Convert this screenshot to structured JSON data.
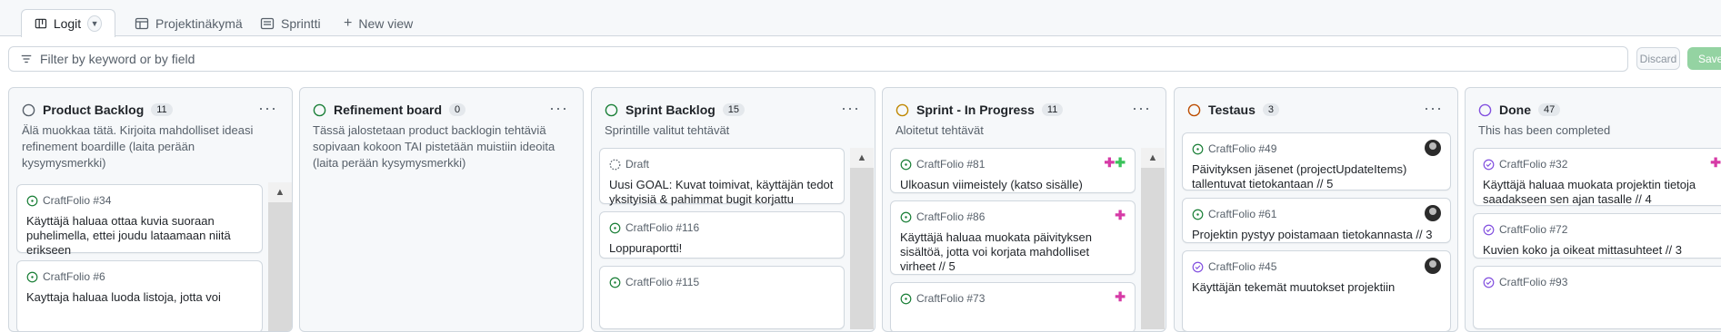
{
  "tabs": [
    {
      "label": "Logit",
      "icon": "table-icon"
    },
    {
      "label": "Projektinäkymä",
      "icon": "table-icon"
    },
    {
      "label": "Sprintti",
      "icon": "board-icon"
    },
    {
      "label": "New view",
      "icon": "plus-icon"
    }
  ],
  "filter": {
    "placeholder": "Filter by keyword or by field"
  },
  "actions": {
    "discard": "Discard",
    "save": "Save"
  },
  "colors": {
    "open": "#1a7f37",
    "todo": "#57606a",
    "progress": "#bf8700",
    "testing": "#bc4c00",
    "done": "#8250df",
    "label": "#d63aa6"
  },
  "columns": [
    {
      "title": "Product Backlog",
      "count": "11",
      "description": "Älä muokkaa tätä. Kirjoita mahdolliset ideasi refinement boardille (laita perään kysymysmerkki)",
      "cards": [
        {
          "meta": "CraftFolio #34",
          "title": "Käyttäjä haluaa ottaa kuvia suoraan puhelimella, ettei joudu lataamaan niitä erikseen"
        },
        {
          "meta": "CraftFolio #6",
          "title": "Kayttaja haluaa luoda listoja, jotta voi"
        }
      ]
    },
    {
      "title": "Refinement board",
      "count": "0",
      "description": "Tässä jalostetaan product backlogin tehtäviä sopivaan kokoon TAI pistetään muistiin ideoita (laita perään kysymysmerkki)",
      "cards": []
    },
    {
      "title": "Sprint Backlog",
      "count": "15",
      "description": "Sprintille valitut tehtävät",
      "cards": [
        {
          "meta": "Draft",
          "title": "Uusi GOAL: Kuvat toimivat, käyttäjän tedot yksityisiä & pahimmat bugit korjattu"
        },
        {
          "meta": "CraftFolio #116",
          "title": "Loppuraportti!"
        },
        {
          "meta": "CraftFolio #115",
          "title": ""
        }
      ]
    },
    {
      "title": "Sprint - In Progress",
      "count": "11",
      "description": "Aloitetut tehtävät",
      "cards": [
        {
          "meta": "CraftFolio #81",
          "title": "Ulkoasun viimeistely (katso sisälle)"
        },
        {
          "meta": "CraftFolio #86",
          "title": "Käyttäjä haluaa muokata päivityksen sisältöä, jotta voi korjata mahdolliset virheet // 5"
        },
        {
          "meta": "CraftFolio #73",
          "title": ""
        }
      ]
    },
    {
      "title": "Testaus",
      "count": "3",
      "description": "",
      "cards": [
        {
          "meta": "CraftFolio #49",
          "title": "Päivityksen jäsenet (projectUpdateItems) tallentuvat tietokantaan // 5"
        },
        {
          "meta": "CraftFolio #61",
          "title": "Projektin pystyy poistamaan tietokannasta // 3"
        },
        {
          "meta": "CraftFolio #45",
          "title": "Käyttäjän tekemät muutokset projektiin"
        }
      ]
    },
    {
      "title": "Done",
      "count": "47",
      "description": "This has been completed",
      "cards": [
        {
          "meta": "CraftFolio #32",
          "title": "Käyttäjä haluaa muokata projektin tietoja saadakseen sen ajan tasalle // 4"
        },
        {
          "meta": "CraftFolio #72",
          "title": "Kuvien koko ja oikeat mittasuhteet // 3"
        },
        {
          "meta": "CraftFolio #93",
          "title": ""
        }
      ]
    }
  ]
}
